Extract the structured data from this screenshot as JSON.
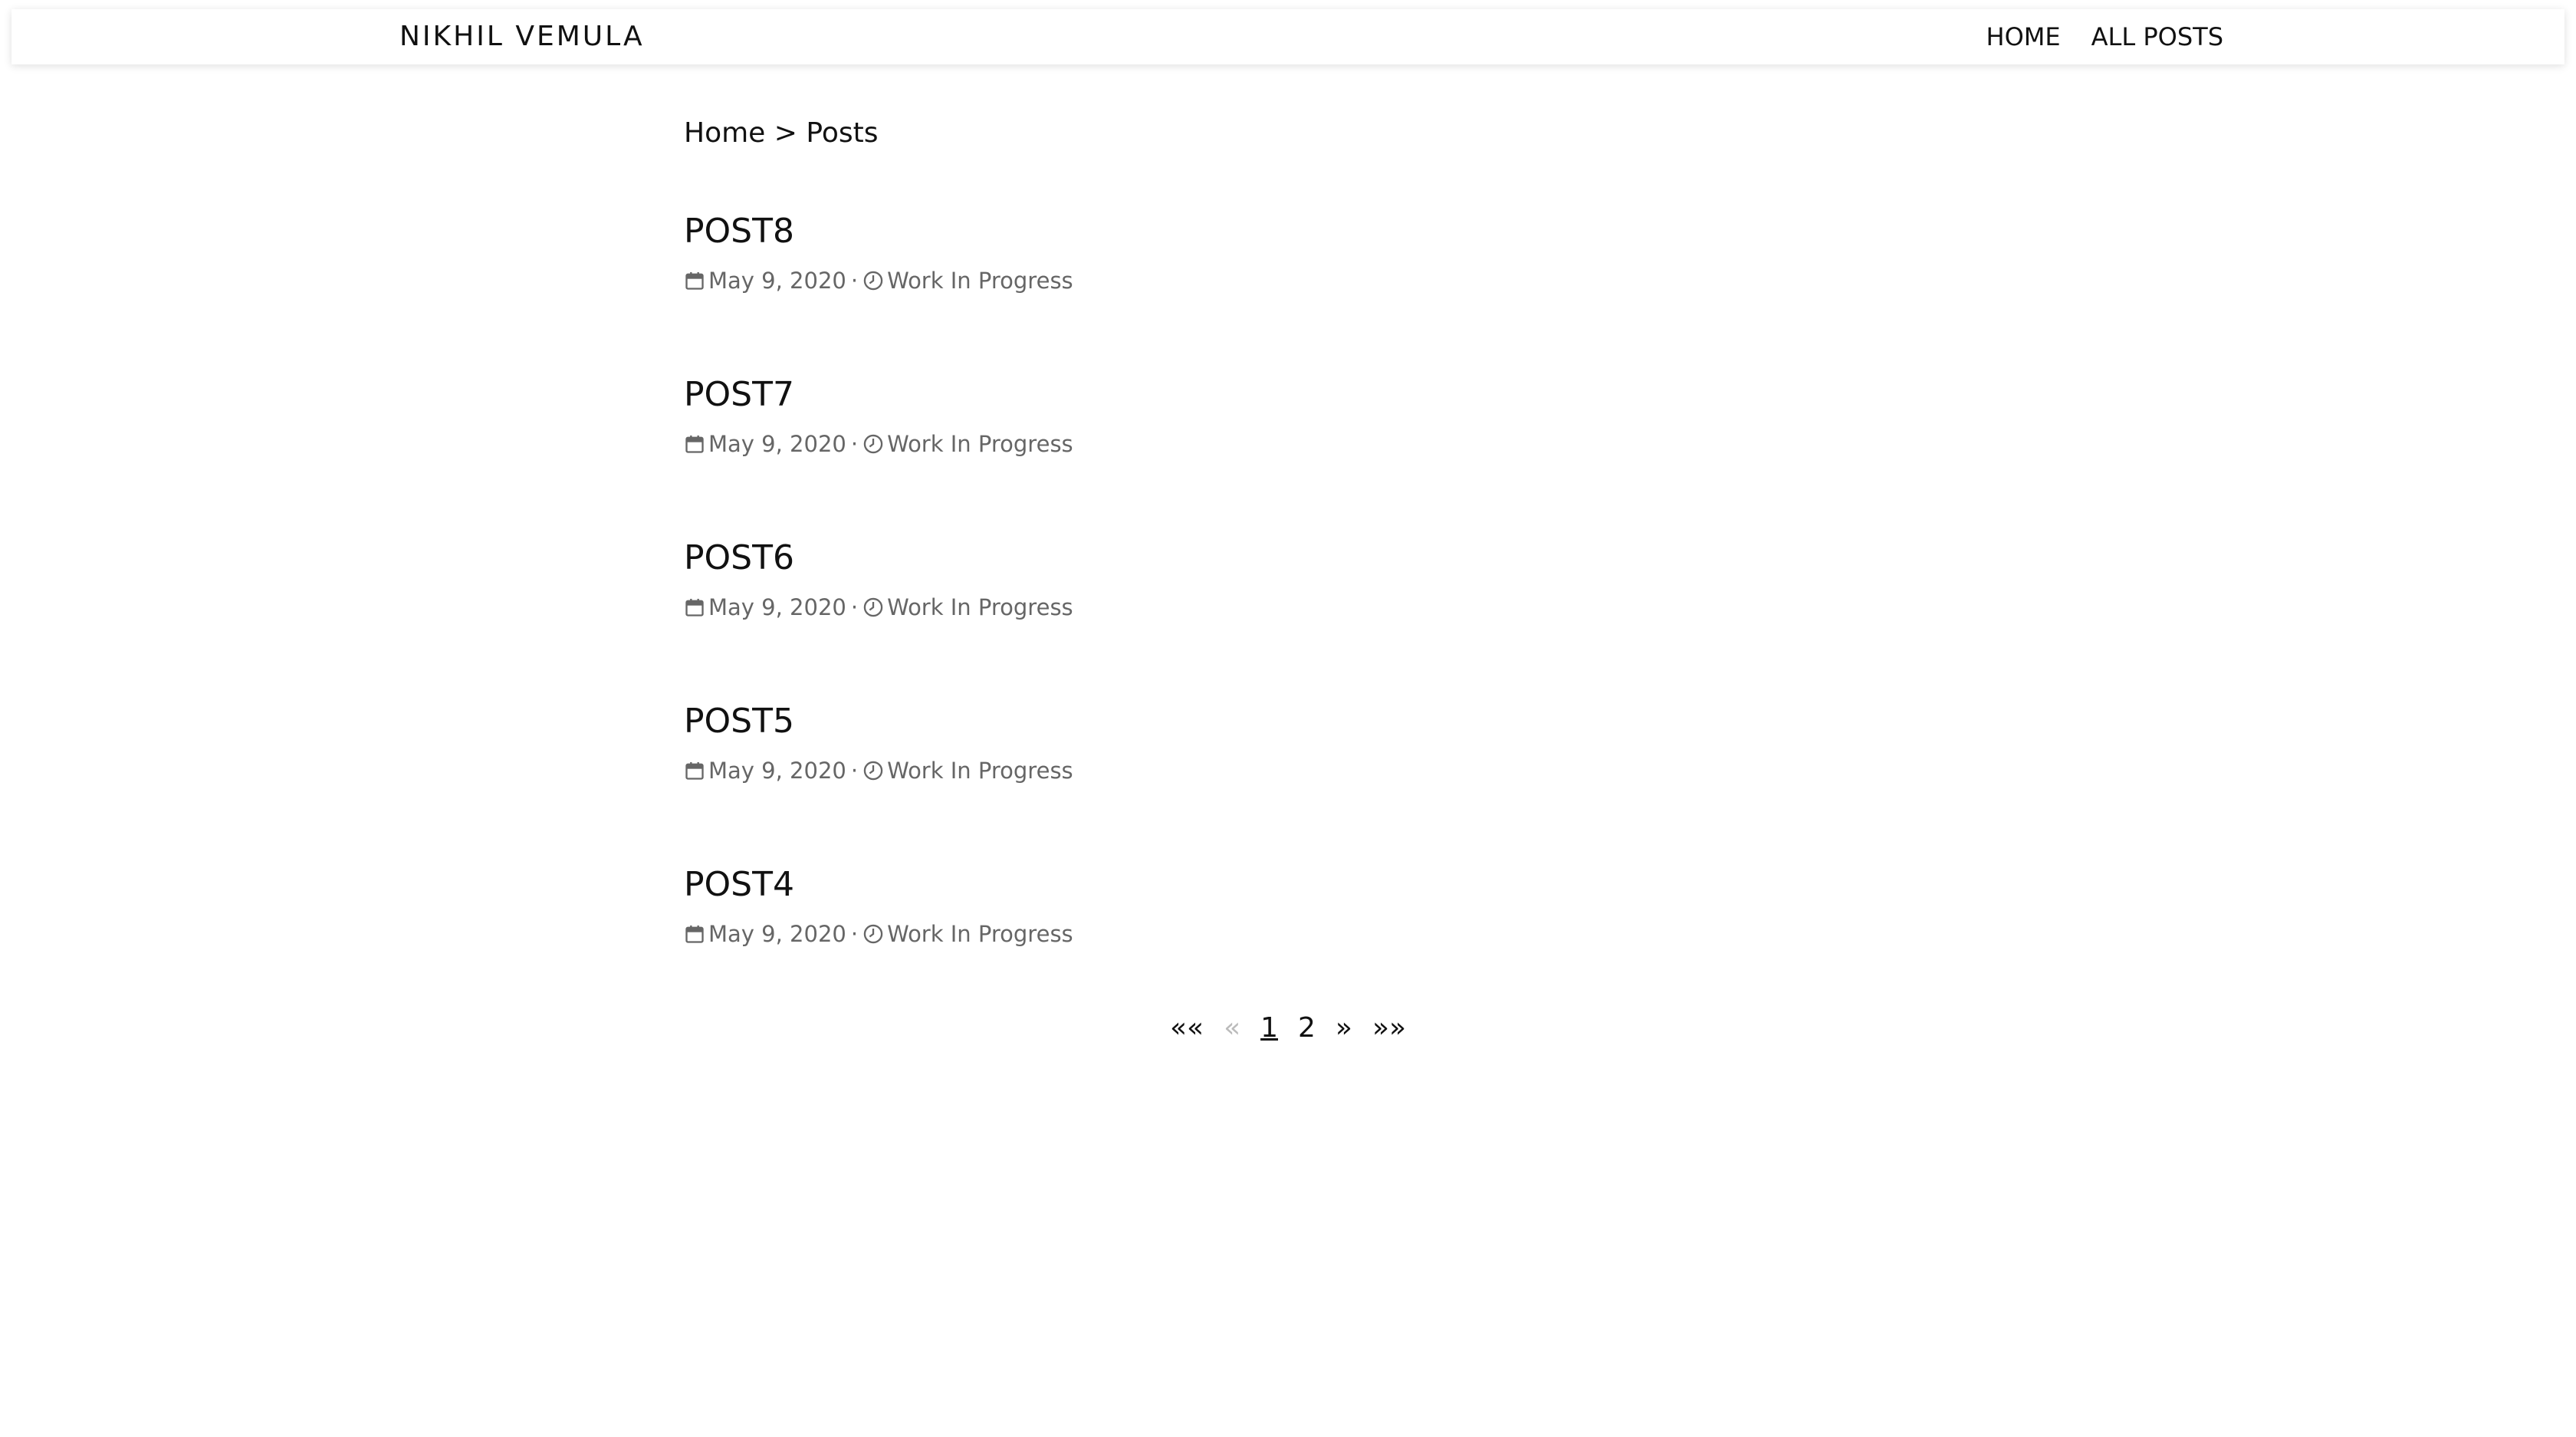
{
  "nav": {
    "brand": "NIKHIL VEMULA",
    "links": [
      {
        "label": "HOME"
      },
      {
        "label": "ALL POSTS"
      }
    ]
  },
  "breadcrumb": {
    "home": "Home",
    "separator": ">",
    "current": "Posts"
  },
  "posts": [
    {
      "title": "POST8",
      "date": "May 9, 2020",
      "dot": "·",
      "reading_time": "Work In Progress"
    },
    {
      "title": "POST7",
      "date": "May 9, 2020",
      "dot": "·",
      "reading_time": "Work In Progress"
    },
    {
      "title": "POST6",
      "date": "May 9, 2020",
      "dot": "·",
      "reading_time": "Work In Progress"
    },
    {
      "title": "POST5",
      "date": "May 9, 2020",
      "dot": "·",
      "reading_time": "Work In Progress"
    },
    {
      "title": "POST4",
      "date": "May 9, 2020",
      "dot": "·",
      "reading_time": "Work In Progress"
    }
  ],
  "pagination": {
    "first": "««",
    "prev": "«",
    "pages": [
      "1",
      "2"
    ],
    "next": "»",
    "last": "»»"
  },
  "icons": {
    "date": "calendar-icon",
    "time": "clock-icon"
  }
}
